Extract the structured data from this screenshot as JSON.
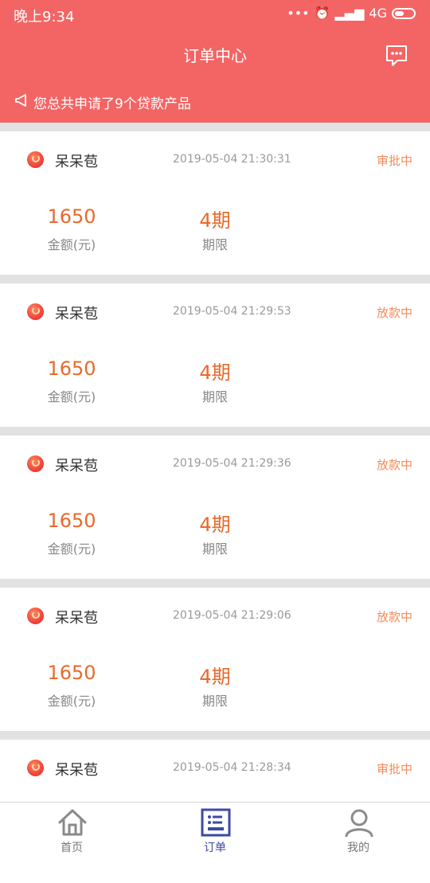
{
  "status_bar": {
    "time": "晚上9:34",
    "network": "4G"
  },
  "header": {
    "title": "订单中心",
    "message_icon": "chat-bubble-icon"
  },
  "notice": {
    "text": "您总共申请了9个贷款产品",
    "icon": "megaphone-icon"
  },
  "orders": [
    {
      "name": "呆呆苞",
      "time": "2019-05-04 21:30:31",
      "status": "审批中",
      "amount": "1650",
      "amount_label": "金额(元)",
      "period": "4期",
      "period_label": "期限"
    },
    {
      "name": "呆呆苞",
      "time": "2019-05-04 21:29:53",
      "status": "放款中",
      "amount": "1650",
      "amount_label": "金额(元)",
      "period": "4期",
      "period_label": "期限"
    },
    {
      "name": "呆呆苞",
      "time": "2019-05-04 21:29:36",
      "status": "放款中",
      "amount": "1650",
      "amount_label": "金额(元)",
      "period": "4期",
      "period_label": "期限"
    },
    {
      "name": "呆呆苞",
      "time": "2019-05-04 21:29:06",
      "status": "放款中",
      "amount": "1650",
      "amount_label": "金额(元)",
      "period": "4期",
      "period_label": "期限"
    },
    {
      "name": "呆呆苞",
      "time": "2019-05-04 21:28:34",
      "status": "审批中",
      "amount": "",
      "amount_label": "",
      "period": "",
      "period_label": ""
    }
  ],
  "tabs": [
    {
      "label": "首页",
      "icon": "home-icon",
      "active": false
    },
    {
      "label": "订单",
      "icon": "order-list-icon",
      "active": true
    },
    {
      "label": "我的",
      "icon": "user-icon",
      "active": false
    }
  ],
  "colors": {
    "primary": "#f36564",
    "accent": "#e8692a",
    "tab_active": "#3e4aa3"
  }
}
